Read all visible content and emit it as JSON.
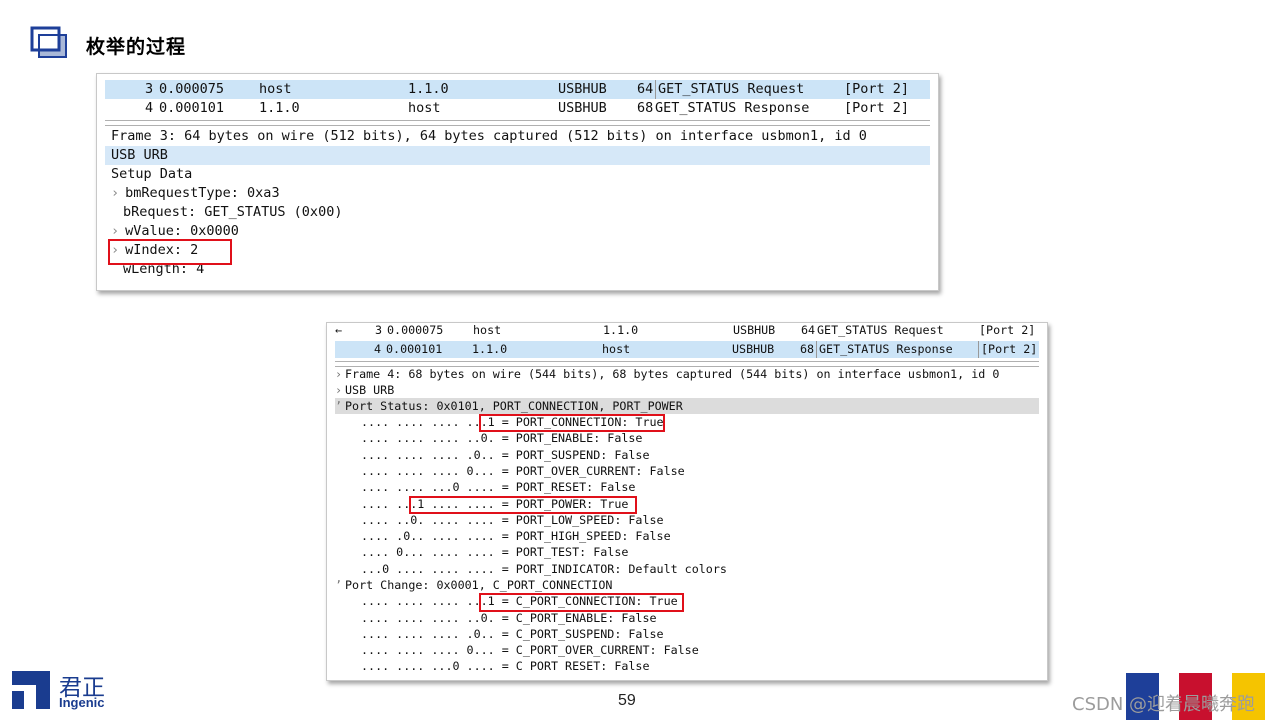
{
  "slide": {
    "title": "枚举的过程",
    "page_number": "59",
    "logo": {
      "cn": "君正",
      "en": "Ingenic"
    },
    "watermark": "CSDN @迎着晨曦奔跑",
    "colors": {
      "brand_blue": "#1a3c8f",
      "square_blue": "#1e3f99",
      "square_red": "#c8102e",
      "square_yellow": "#f5c400",
      "highlight_red": "#e0101a"
    }
  },
  "capture1": {
    "packets": [
      {
        "no": "3",
        "time": "0.000075",
        "src": "host",
        "dst": "1.1.0",
        "proto": "USBHUB",
        "len": "64",
        "info": "GET_STATUS Request",
        "port": "[Port 2]"
      },
      {
        "no": "4",
        "time": "0.000101",
        "src": "1.1.0",
        "dst": "host",
        "proto": "USBHUB",
        "len": "68",
        "info": "GET_STATUS Response",
        "port": "[Port 2]"
      }
    ],
    "details": [
      "Frame 3: 64 bytes on wire (512 bits), 64 bytes captured (512 bits) on interface usbmon1, id 0",
      "USB URB",
      "Setup Data",
      "bmRequestType: 0xa3",
      "bRequest: GET_STATUS (0x00)",
      "wValue: 0x0000",
      "wIndex: 2",
      "wLength: 4"
    ]
  },
  "capture2": {
    "packets": [
      {
        "no": "3",
        "time": "0.000075",
        "src": "host",
        "dst": "1.1.0",
        "proto": "USBHUB",
        "len": "64",
        "info": "GET_STATUS Request",
        "port": "[Port 2]"
      },
      {
        "no": "4",
        "time": "0.000101",
        "src": "1.1.0",
        "dst": "host",
        "proto": "USBHUB",
        "len": "68",
        "info": "GET_STATUS Response",
        "port": "[Port 2]"
      }
    ],
    "details": [
      "Frame 4: 68 bytes on wire (544 bits), 68 bytes captured (544 bits) on interface usbmon1, id 0",
      "USB URB",
      "Port Status: 0x0101, PORT_CONNECTION, PORT_POWER",
      ".... .... .... ...1 = PORT_CONNECTION: True",
      ".... .... .... ..0. = PORT_ENABLE: False",
      ".... .... .... .0.. = PORT_SUSPEND: False",
      ".... .... .... 0... = PORT_OVER_CURRENT: False",
      ".... .... ...0 .... = PORT_RESET: False",
      ".... ...1 .... .... = PORT_POWER: True",
      ".... ..0. .... .... = PORT_LOW_SPEED: False",
      ".... .0.. .... .... = PORT_HIGH_SPEED: False",
      ".... 0... .... .... = PORT_TEST: False",
      "...0 .... .... .... = PORT_INDICATOR: Default colors",
      "Port Change: 0x0001, C_PORT_CONNECTION",
      ".... .... .... ...1 = C_PORT_CONNECTION: True",
      ".... .... .... ..0. = C_PORT_ENABLE: False",
      ".... .... .... .0.. = C_PORT_SUSPEND: False",
      ".... .... .... 0... = C_PORT_OVER_CURRENT: False",
      ".... .... ...0 .... = C PORT RESET: False"
    ]
  }
}
